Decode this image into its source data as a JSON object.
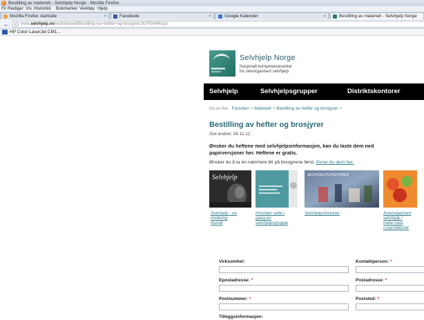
{
  "browser": {
    "window_title": "Bestilling av materiell - Selvhjelp Norge - Mozilla Firefox",
    "menu": [
      "Fil",
      "Rediger",
      "Vis",
      "Historikk",
      "Bokmerker",
      "Verktøy",
      "Hjelp"
    ],
    "tabs": [
      {
        "label": "Mozilla Firefox startside",
        "icon": "firefox-icon"
      },
      {
        "label": "Facebook",
        "icon": "facebook-icon"
      },
      {
        "label": "Google Kalender",
        "icon": "calendar-icon"
      },
      {
        "label": "Bestilling av materiell - Selvhjelp Norge",
        "icon": "site-icon",
        "active": true
      }
    ],
    "url_prefix": "www.",
    "url_domain": "selvhjelp.no",
    "url_path": "/no/Materiell/Bestilling+av+hefter+og+brosjyrer.9UFRHM4i.ips",
    "bookmark": "HP Color LaserJet CM1..."
  },
  "site": {
    "brand": "Selvhjelp Norge",
    "tagline_line1": "Nasjonalt kompetansesenter",
    "tagline_line2": "for selvorganisert selvhjelp",
    "nav": [
      "Selvhjelp",
      "Selvhjelpsgrupper",
      "Distriktskontorer"
    ]
  },
  "breadcrumb": {
    "prefix": "Du er her:",
    "items": [
      "Forsiden",
      "Materiell",
      "Bestilling av hefter og brosjyrer"
    ],
    "sep": ">"
  },
  "page": {
    "title": "Bestilling av hefter og brosjyrer",
    "updated": "Sist endret: 26.11.12",
    "intro_line1": "Ønsker du heftene med selvhjelpsinformasjon, kan du laste dem ned",
    "intro_line2": "papirversjoner her. Heftene er gratis.",
    "preview_text": "Ønsker du å ta en nærmere titt på brosjyrene først,",
    "preview_link": "finner du dem her."
  },
  "booklets": [
    {
      "label_lines": [
        "Selvhjelp - en",
        "innføring",
        "thumb"
      ],
      "cover_title": "Selvhjelp",
      "cover_color": "#2a2a2a"
    },
    {
      "label_lines": [
        "Hvordan sette i",
        "gang en",
        "selvhjelpsgruppe"
      ],
      "cover_title": "",
      "cover_color": "#4e9aa0"
    },
    {
      "label_lines": [
        "Selvhjelpshistorier"
      ],
      "cover_title": "SELVHJELPS-HISTORIER",
      "cover_color": "#5a6f8e"
    },
    {
      "label_lines": [
        "Selvorganisert",
        "selvhjelp i",
        "møte med",
        "rusproblemer"
      ],
      "cover_title": "",
      "cover_color": "#e8692a"
    }
  ],
  "form": {
    "fields": [
      {
        "label": "Virksomhet:",
        "required": false
      },
      {
        "label": "Kontaktperson:",
        "required": true
      },
      {
        "label": "Epostadresse:",
        "required": true
      },
      {
        "label": "Postadresse:",
        "required": true
      },
      {
        "label": "Postnummer:",
        "required": true
      },
      {
        "label": "Poststed:",
        "required": true
      },
      {
        "label": "Tilleggsinformasjon:",
        "required": false
      }
    ],
    "required_mark": "*"
  },
  "colors": {
    "accent": "#2f7a86",
    "title": "#2b6a76",
    "nav_bg": "#000000",
    "required": "#dd2222"
  }
}
